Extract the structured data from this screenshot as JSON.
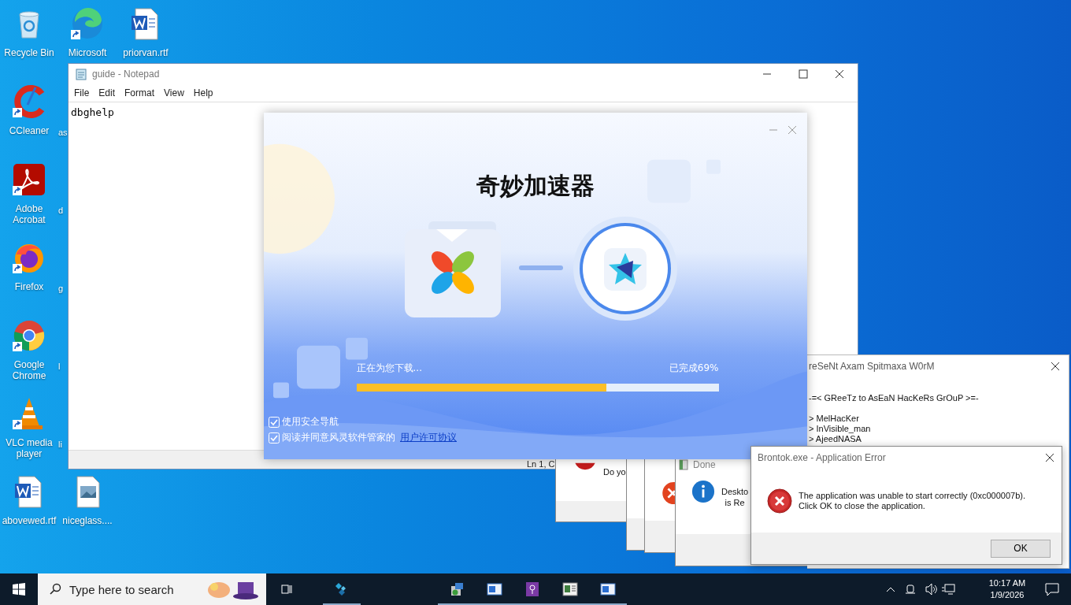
{
  "desktop": {
    "columns": [
      [
        {
          "label": "Recycle Bin",
          "kind": "recycle",
          "shortcut": false
        },
        {
          "label": "CCleaner",
          "kind": "ccleaner",
          "shortcut": true
        },
        {
          "label": "Adobe Acrobat",
          "kind": "acrobat",
          "shortcut": true
        },
        {
          "label": "Firefox",
          "kind": "firefox",
          "shortcut": true
        },
        {
          "label": "Google Chrome",
          "kind": "chrome",
          "shortcut": true
        },
        {
          "label": "VLC media player",
          "kind": "vlc",
          "shortcut": true
        },
        {
          "label": "abovewed.rtf",
          "kind": "word",
          "shortcut": false
        }
      ],
      [
        {
          "label": "Microsoft",
          "kind": "edge",
          "shortcut": true
        },
        {
          "label": "as",
          "kind": "hidden"
        },
        {
          "label": "d",
          "kind": "hidden"
        },
        {
          "label": "g",
          "kind": "hidden"
        },
        {
          "label": "l",
          "kind": "hidden"
        },
        {
          "label": "li",
          "kind": "hidden"
        },
        {
          "label": "niceglass....",
          "kind": "image",
          "shortcut": false
        }
      ],
      [
        {
          "label": "priorvan.rtf",
          "kind": "word",
          "shortcut": false
        }
      ]
    ]
  },
  "notepad": {
    "title": "guide - Notepad",
    "menu": [
      "File",
      "Edit",
      "Format",
      "View",
      "Help"
    ],
    "text": "dbghelp",
    "status": "Ln 1, C"
  },
  "installer": {
    "title": "奇妙加速器",
    "status": "正在为您下载...",
    "percent": "已完成69%",
    "level": 0.69,
    "options": [
      {
        "label": "使用安全导航",
        "checked": true
      },
      {
        "label": "阅读并同意风灵软件管家的",
        "link": "用户许可协议",
        "checked": true
      }
    ]
  },
  "worm_window": {
    "title": "reSeNt Axam Spitmaxa W0rM",
    "lines": [
      "-=< GReeTz to AsEaN HacKeRs GrOuP >=-",
      "> MelHacKer",
      "> InVisible_man",
      "> AjeedNASA"
    ]
  },
  "background_dialogs": [
    {
      "kind": "question",
      "lines": [
        "Do yo"
      ]
    },
    {
      "kind": "plain"
    },
    {
      "kind": "error"
    },
    {
      "kind": "info",
      "title": "Done",
      "lines": [
        "Deskto",
        "is Re"
      ]
    }
  ],
  "error_dialog": {
    "title": "Brontok.exe - Application Error",
    "message": [
      "The application was unable to start correctly (0xc000007b).",
      "Click OK to close the application."
    ],
    "button": "OK"
  },
  "taskbar": {
    "search_placeholder": "Type here to search",
    "apps": [
      {
        "kind": "tiles",
        "running": true
      },
      {
        "kind": "installer",
        "running": true
      },
      {
        "kind": "window",
        "running": true
      },
      {
        "kind": "purple",
        "running": true
      },
      {
        "kind": "document",
        "running": true
      },
      {
        "kind": "window",
        "running": true
      }
    ],
    "time": "10:17 AM",
    "date": "1/9/2026"
  }
}
